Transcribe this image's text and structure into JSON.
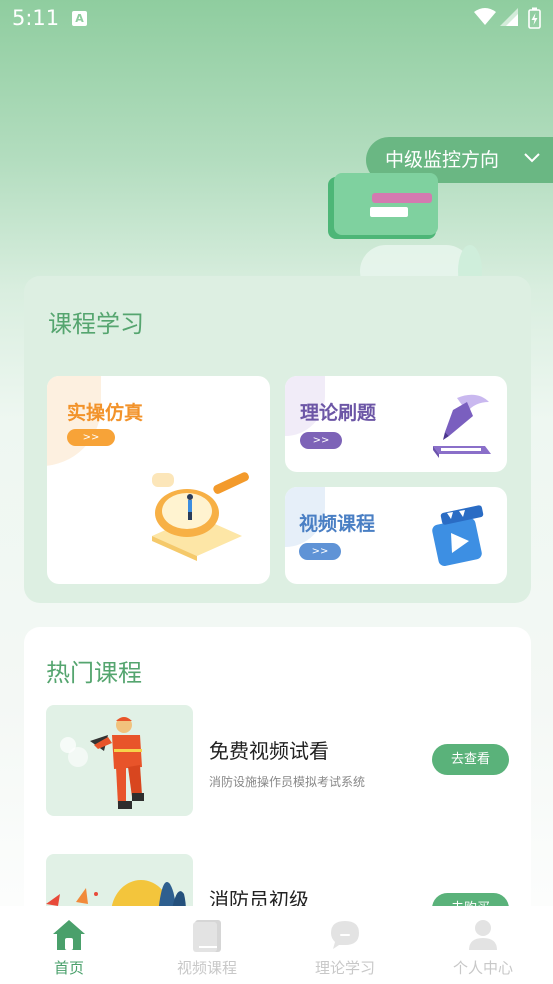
{
  "status_bar": {
    "time": "5:11",
    "notification_icon": "a-icon",
    "wifi_icon": "wifi-icon",
    "signal_icon": "signal-icon",
    "battery_icon": "battery-charging-icon"
  },
  "header": {
    "direction_label": "中级监控方向",
    "direction_icon": "chevron-down-icon"
  },
  "study": {
    "title": "课程学习",
    "tiles": [
      {
        "label": "实操仿真",
        "arrow": ">>",
        "icon": "magnifier-figure-illustration",
        "color": "#f2932b"
      },
      {
        "label": "理论刷题",
        "arrow": ">>",
        "icon": "pen-book-illustration",
        "color": "#6c56a6"
      },
      {
        "label": "视频课程",
        "arrow": ">>",
        "icon": "video-play-illustration",
        "color": "#4a7fc4"
      }
    ]
  },
  "hot_courses": {
    "title": "热门课程",
    "items": [
      {
        "name": "免费视频试看",
        "desc": "消防设施操作员模拟考试系统",
        "button": "去查看",
        "thumb": "firefighter-illustration"
      },
      {
        "name": "消防员初级",
        "desc": "",
        "button": "去购买",
        "thumb": "flame-trees-illustration"
      }
    ]
  },
  "nav": {
    "items": [
      {
        "label": "首页",
        "icon": "home-icon",
        "active": true
      },
      {
        "label": "视频课程",
        "icon": "book-icon",
        "active": false
      },
      {
        "label": "理论学习",
        "icon": "chat-bubble-icon",
        "active": false
      },
      {
        "label": "个人中心",
        "icon": "person-icon",
        "active": false
      }
    ]
  },
  "colors": {
    "accent": "#55a56f",
    "button": "#5ab27a",
    "nav_active": "#4aa06b"
  }
}
